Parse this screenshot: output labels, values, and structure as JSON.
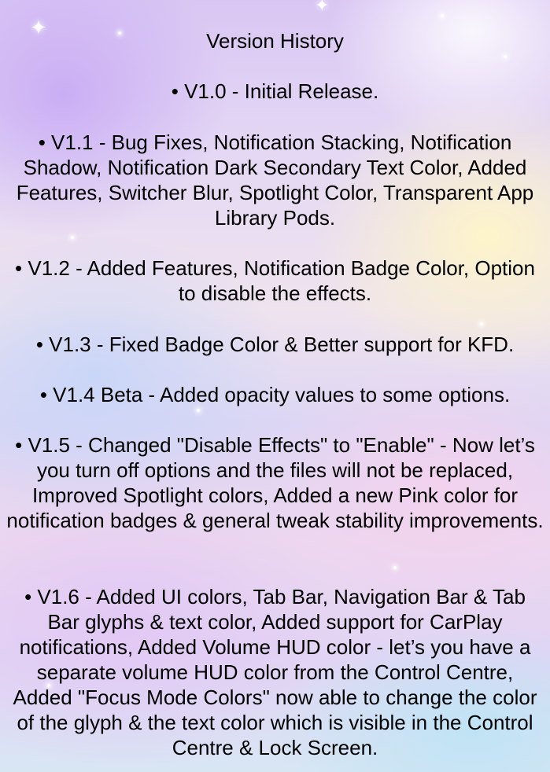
{
  "document": {
    "title": "Version History",
    "entries": [
      "• V1.0 - Initial Release.",
      "• V1.1 - Bug Fixes, Notification Stacking, Notification Shadow, Notification Dark Secondary Text Color, Added Features, Switcher Blur, Spotlight Color, Transparent App Library Pods.",
      "• V1.2 - Added Features, Notification Badge Color, Option to disable the effects.",
      "• V1.3 - Fixed Badge Color & Better support for KFD.",
      "• V1.4 Beta - Added opacity values to some options.",
      "• V1.5 - Changed \"Disable Effects\" to \"Enable\" - Now let’s you turn off options and the files will not be replaced, Improved Spotlight colors, Added a new Pink color for notification badges & general tweak stability improvements.",
      "• V1.6 - Added UI colors, Tab Bar, Navigation Bar & Tab Bar glyphs & text color, Added support for CarPlay notifications, Added Volume HUD color - let’s you have a separate volume HUD color from the Control Centre, Added \"Focus Mode Colors\" now able to change the color of the glyph & the text color which is visible in the Control Centre & Lock Screen."
    ]
  }
}
